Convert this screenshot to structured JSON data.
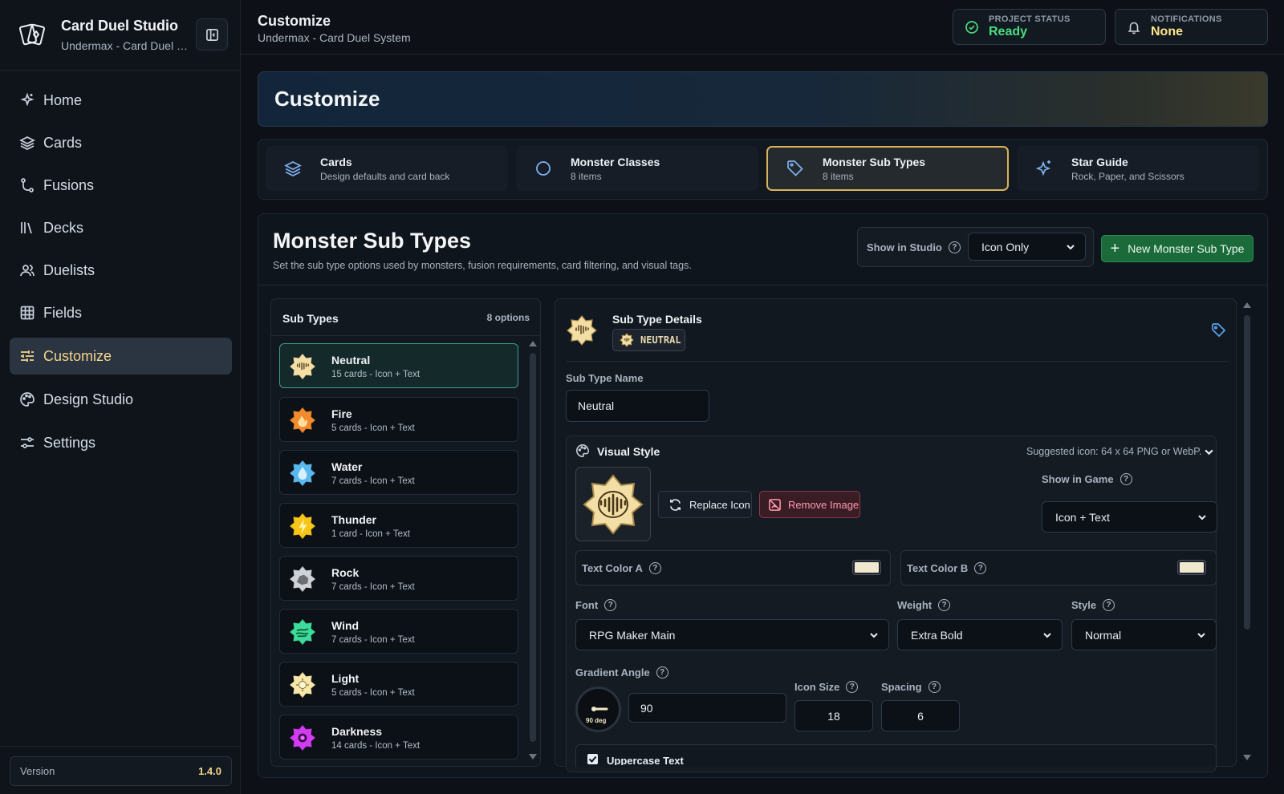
{
  "app": {
    "title": "Card Duel Studio",
    "project": "Undermax - Card Duel S..."
  },
  "nav": [
    {
      "label": "Home",
      "icon": "sparkle-icon"
    },
    {
      "label": "Cards",
      "icon": "layers-icon"
    },
    {
      "label": "Fusions",
      "icon": "fusion-icon"
    },
    {
      "label": "Decks",
      "icon": "library-icon"
    },
    {
      "label": "Duelists",
      "icon": "users-icon"
    },
    {
      "label": "Fields",
      "icon": "grid-icon"
    },
    {
      "label": "Customize",
      "icon": "sliders-icon",
      "active": true
    },
    {
      "label": "Design Studio",
      "icon": "palette-icon"
    },
    {
      "label": "Settings",
      "icon": "settings-icon"
    }
  ],
  "version": {
    "label": "Version",
    "value": "1.4.0"
  },
  "header": {
    "title": "Customize",
    "subtitle": "Undermax - Card Duel System",
    "project_status": {
      "label": "PROJECT STATUS",
      "value": "Ready",
      "color": "#4ade80"
    },
    "notifications": {
      "label": "NOTIFICATIONS",
      "value": "None",
      "color": "#fde68a"
    }
  },
  "banner": {
    "title": "Customize"
  },
  "tabs": [
    {
      "title": "Cards",
      "sub": "Design defaults and card back",
      "icon": "layers-icon"
    },
    {
      "title": "Monster Classes",
      "sub": "8 items",
      "icon": "circle-icon"
    },
    {
      "title": "Monster Sub Types",
      "sub": "8 items",
      "icon": "tag-icon",
      "active": true
    },
    {
      "title": "Star Guide",
      "sub": "Rock, Paper, and Scissors",
      "icon": "sparkle-icon"
    }
  ],
  "section": {
    "title": "Monster Sub Types",
    "subtitle": "Set the sub type options used by monsters, fusion requirements, card filtering, and visual tags.",
    "show_in_studio_label": "Show in Studio",
    "show_in_studio_value": "Icon Only",
    "new_button": "New Monster Sub Type"
  },
  "subtypes": {
    "header": "Sub Types",
    "count": "8 options",
    "items": [
      {
        "name": "Neutral",
        "desc": "15 cards - Icon + Text",
        "color": "#f3dfa6",
        "active": true
      },
      {
        "name": "Fire",
        "desc": "5 cards - Icon + Text",
        "color": "#f28a2e"
      },
      {
        "name": "Water",
        "desc": "7 cards - Icon + Text",
        "color": "#5ab8f0"
      },
      {
        "name": "Thunder",
        "desc": "1 card - Icon + Text",
        "color": "#f5c518"
      },
      {
        "name": "Rock",
        "desc": "7 cards - Icon + Text",
        "color": "#cfd2d6"
      },
      {
        "name": "Wind",
        "desc": "7 cards - Icon + Text",
        "color": "#3ddc9a"
      },
      {
        "name": "Light",
        "desc": "5 cards - Icon + Text",
        "color": "#f7e7a8"
      },
      {
        "name": "Darkness",
        "desc": "14 cards - Icon + Text",
        "color": "#d13cf0"
      }
    ]
  },
  "details": {
    "title": "Sub Type Details",
    "badge": "NEUTRAL",
    "name_label": "Sub Type Name",
    "name_value": "Neutral",
    "visual_style": "Visual Style",
    "hint": "Suggested icon: 64 x 64 PNG or WebP.",
    "replace_icon": "Replace Icon",
    "remove_image": "Remove Image",
    "show_in_game_label": "Show in Game",
    "show_in_game_value": "Icon + Text",
    "text_color_a": "Text Color A",
    "text_color_b": "Text Color B",
    "font_label": "Font",
    "font_value": "RPG Maker Main",
    "weight_label": "Weight",
    "weight_value": "Extra Bold",
    "style_label": "Style",
    "style_value": "Normal",
    "gradient_label": "Gradient Angle",
    "gradient_value": "90",
    "dial_label": "90 deg",
    "icon_size_label": "Icon Size",
    "icon_size_value": "18",
    "spacing_label": "Spacing",
    "spacing_value": "6",
    "uppercase_label": "Uppercase Text"
  }
}
